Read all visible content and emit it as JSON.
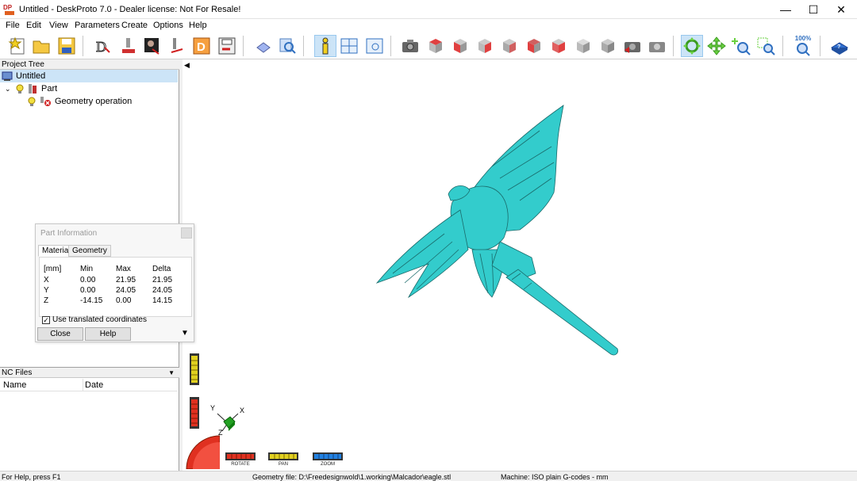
{
  "window": {
    "title": "Untitled - DeskProto 7.0 - Dealer license: Not For Resale!",
    "minimize": "—",
    "maximize": "☐",
    "close": "✕"
  },
  "menu": [
    "File",
    "Edit",
    "View",
    "Parameters",
    "Create",
    "Options",
    "Help"
  ],
  "toolbar": {
    "zoom_level": "100%"
  },
  "project_tree": {
    "header": "Project Tree",
    "root": "Untitled",
    "part": "Part",
    "operation": "Geometry operation"
  },
  "nc_files": {
    "header": "NC Files",
    "col_name": "Name",
    "col_date": "Date"
  },
  "part_info": {
    "title": "Part Information",
    "tabs": [
      "Material",
      "Geometry"
    ],
    "headers": [
      "[mm]",
      "Min",
      "Max",
      "Delta"
    ],
    "rows": [
      {
        "axis": "X",
        "min": "0.00",
        "max": "21.95",
        "delta": "21.95"
      },
      {
        "axis": "Y",
        "min": "0.00",
        "max": "24.05",
        "delta": "24.05"
      },
      {
        "axis": "Z",
        "min": "-14.15",
        "max": "0.00",
        "delta": "14.15"
      }
    ],
    "checkbox_label": "Use translated coordinates",
    "checkbox_checked": "✓",
    "close_label": "Close",
    "help_label": "Help"
  },
  "axes": {
    "x": "X",
    "y": "Y",
    "z": "Z"
  },
  "dials": {
    "rotate": "ROTATE",
    "pan": "PAN",
    "zoom": "ZOOM"
  },
  "status": {
    "help": "For Help, press F1",
    "geometry_file": "Geometry file: D:\\Freedesignwold\\1.working\\Malcador\\eagle.stl",
    "machine": "Machine: ISO plain G-codes - mm"
  },
  "colors": {
    "model": "#33cccc",
    "selection": "#cce4f7",
    "rotate": "#e03020",
    "pan": "#e0d020",
    "zoom": "#2080e0"
  }
}
